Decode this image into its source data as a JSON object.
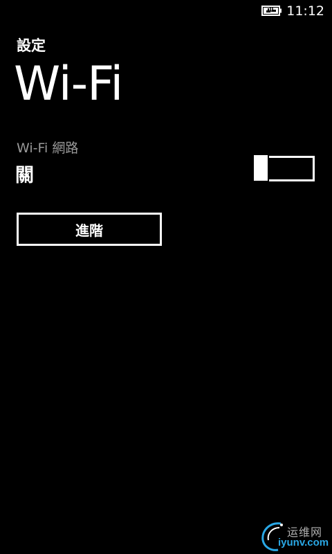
{
  "status_bar": {
    "battery_icon": "battery-charging-icon",
    "time": "11:12"
  },
  "header": {
    "app_title": "設定",
    "page_title": "Wi-Fi"
  },
  "wifi_setting": {
    "label": "Wi-Fi 網路",
    "value": "關",
    "toggle_on": false
  },
  "advanced_button": {
    "label": "進階"
  },
  "watermark": {
    "chinese_text": "运维网",
    "url_text": "iyunv.com"
  },
  "colors": {
    "background": "#000000",
    "foreground": "#ffffff",
    "subtle_text": "#9a9a9a",
    "watermark_blue": "#2aa8e6"
  }
}
